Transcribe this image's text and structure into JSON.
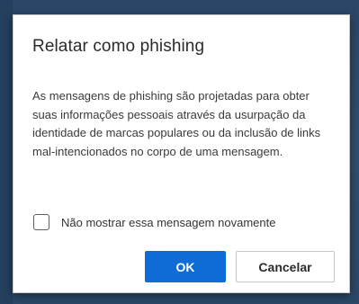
{
  "dialog": {
    "title": "Relatar como phishing",
    "message": "As mensagens de phishing são projetadas para obter suas informações pessoais através da usurpação da identidade de marcas populares ou da inclusão de links mal-intencionados no corpo de uma mensagem.",
    "checkbox": {
      "label": "Não mostrar essa mensagem novamente",
      "checked": false
    },
    "buttons": {
      "ok_label": "OK",
      "cancel_label": "Cancelar"
    }
  },
  "colors": {
    "backdrop": "#2f4d6e",
    "primary_button": "#0f6cd6"
  }
}
